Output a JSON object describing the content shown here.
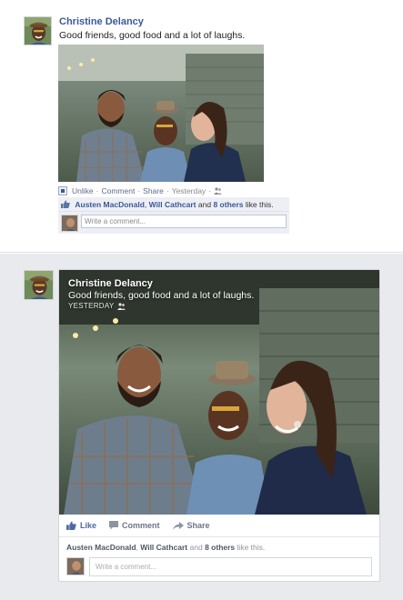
{
  "top_post": {
    "author": "Christine Delancy",
    "status": "Good friends, good food and a lot of laughs.",
    "actions": {
      "unlike": "Unlike",
      "comment": "Comment",
      "share": "Share",
      "time": "Yesterday",
      "sep": "·"
    },
    "likes": {
      "name1": "Austen MacDonald",
      "name2": "Will Cathcart",
      "and": "and",
      "others": "8 others",
      "suffix": "like this."
    },
    "comment_placeholder": "Write a comment..."
  },
  "bottom_post": {
    "author": "Christine Delancy",
    "status": "Good friends, good food and a lot of laughs.",
    "time": "YESTERDAY",
    "actions": {
      "like": "Like",
      "comment": "Comment",
      "share": "Share"
    },
    "likes": {
      "name1": "Austen MacDonald",
      "sep1": ",",
      "name2": "Will Cathcart",
      "and": "and",
      "others": "8 others",
      "suffix": "like this."
    },
    "comment_placeholder": "Write a comment..."
  },
  "colors": {
    "brand_blue": "#3b5998",
    "action_blue": "#4e69a2",
    "page_bg": "#e9eaee"
  },
  "icons": [
    "thumbs-up-icon",
    "comment-bubble-icon",
    "share-arrow-icon",
    "audience-friends-icon"
  ]
}
